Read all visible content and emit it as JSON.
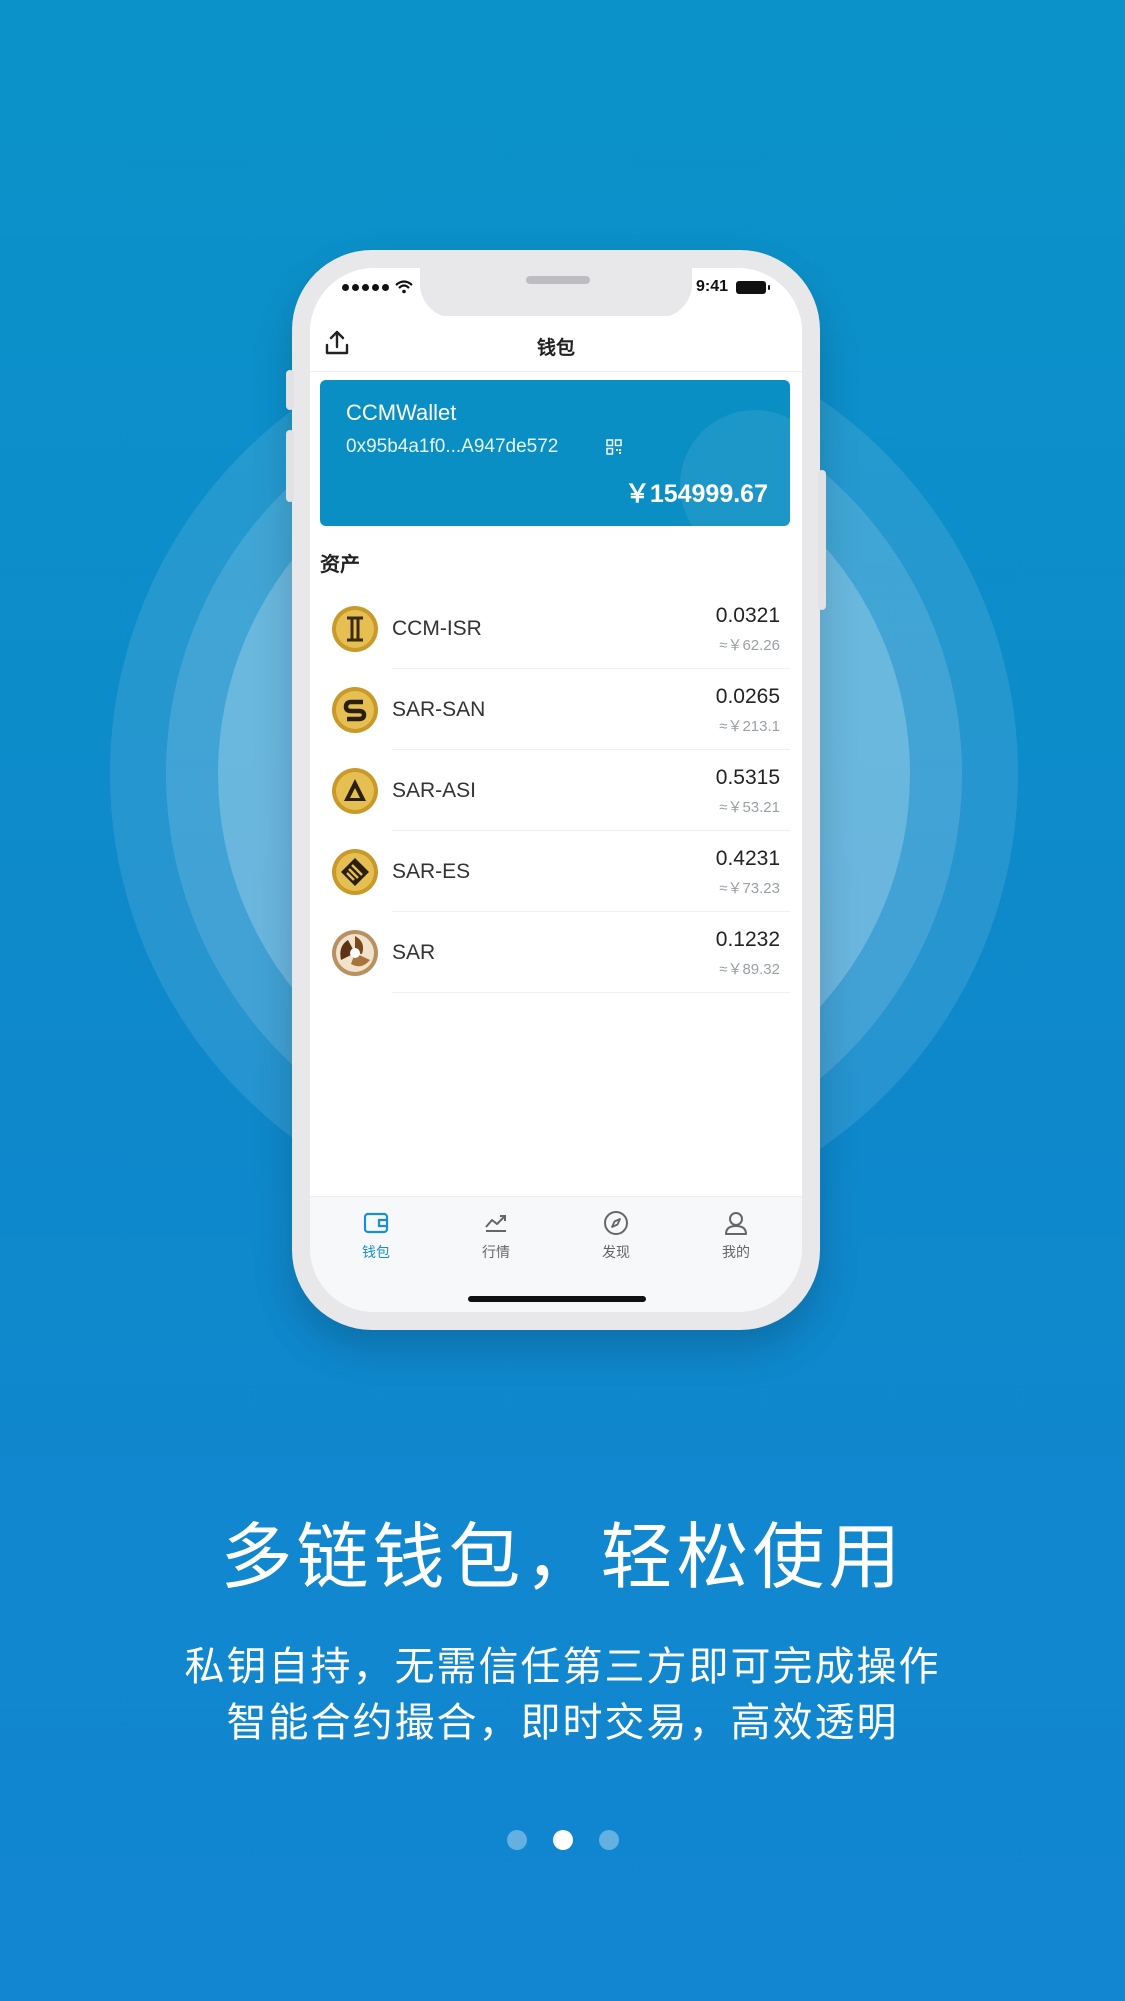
{
  "status_bar": {
    "time": "9:41"
  },
  "nav": {
    "title": "钱包"
  },
  "wallet": {
    "name": "CCMWallet",
    "address": "0x95b4a1f0...A947de572",
    "balance": "￥154999.67"
  },
  "assets_title": "资产",
  "assets": [
    {
      "name": "CCM-ISR",
      "amount": "0.0321",
      "fiat": "≈￥62.26",
      "icon": "ccm-isr-coin-icon"
    },
    {
      "name": "SAR-SAN",
      "amount": "0.0265",
      "fiat": "≈￥213.1",
      "icon": "sar-san-coin-icon"
    },
    {
      "name": "SAR-ASI",
      "amount": "0.5315",
      "fiat": "≈￥53.21",
      "icon": "sar-asi-coin-icon"
    },
    {
      "name": "SAR-ES",
      "amount": "0.4231",
      "fiat": "≈￥73.23",
      "icon": "sar-es-coin-icon"
    },
    {
      "name": "SAR",
      "amount": "0.1232",
      "fiat": "≈￥89.32",
      "icon": "sar-coin-icon"
    }
  ],
  "tabs": [
    {
      "label": "钱包",
      "icon": "wallet-icon",
      "active": true
    },
    {
      "label": "行情",
      "icon": "chart-icon",
      "active": false
    },
    {
      "label": "发现",
      "icon": "compass-icon",
      "active": false
    },
    {
      "label": "我的",
      "icon": "user-icon",
      "active": false
    }
  ],
  "promo": {
    "headline": "多链钱包，轻松使用",
    "line1": "私钥自持，无需信任第三方即可完成操作",
    "line2": "智能合约撮合，即时交易，高效透明"
  },
  "pager": {
    "total": 3,
    "current": 2
  },
  "colors": {
    "background": "#0e88cb",
    "card": "#0a8fc4",
    "accent": "#1a8fd2",
    "coin_gold": "#d4a72c"
  }
}
